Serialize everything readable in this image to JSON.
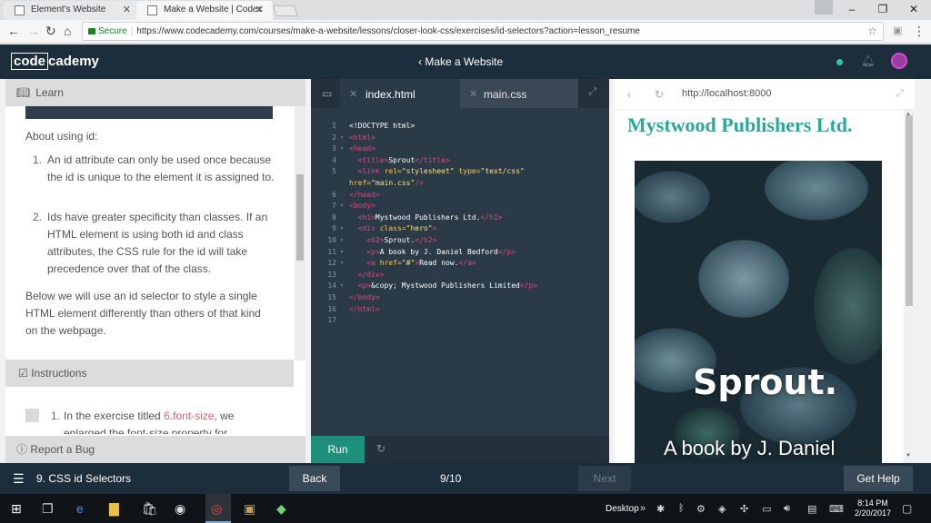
{
  "browser": {
    "tabs": [
      {
        "title": "Element's Website"
      },
      {
        "title": "Make a Website | Codec"
      }
    ],
    "address": {
      "secure_label": "Secure",
      "url": "https://www.codecademy.com/courses/make-a-website/lessons/closer-look-css/exercises/id-selectors?action=lesson_resume"
    }
  },
  "header": {
    "logo_left": "code",
    "logo_right": "cademy",
    "course": "Make a Website"
  },
  "learn": {
    "label": "Learn",
    "intro": "About using id:",
    "points": [
      {
        "num": "1.",
        "line1": "An id attribute can only be used once because",
        "line2": "the id is unique to the element it is assigned to."
      },
      {
        "num": "2.",
        "line1": "Ids have greater specificity than classes. If an",
        "line2": "HTML element is using both id and class",
        "line3": "attributes, the CSS rule for the id will take",
        "line4": "precedence over that of the class."
      }
    ],
    "outro_line1": "Below we will use an id selector to style a single",
    "outro_line2": "HTML element differently than others of that kind",
    "outro_line3": "on the webpage.",
    "instructions_label": "Instructions",
    "task_num": "1.",
    "task_pre": "In the exercise titled ",
    "task_link": "6.font-size",
    "task_post": ", we",
    "task_line2": "enlarged the font-size property for",
    "bug_label": "Report a Bug"
  },
  "editor": {
    "tabs": [
      "index.html",
      "main.css"
    ],
    "run_label": "Run",
    "lines": [
      "1",
      "2",
      "3",
      "4",
      "5",
      "",
      "6",
      "7",
      "8",
      "9",
      "10",
      "11",
      "12",
      "13",
      "14",
      "15",
      "16",
      "17"
    ]
  },
  "preview": {
    "url": "http://localhost:8000",
    "h1": "Mystwood Publishers Ltd.",
    "h2": "Sprout.",
    "p": "A book by J. Daniel"
  },
  "bottom": {
    "lesson": "9. CSS id Selectors",
    "back": "Back",
    "progress": "9/10",
    "next": "Next",
    "help": "Get Help"
  },
  "taskbar": {
    "desktop": "Desktop",
    "time": "8:14 PM",
    "date": "2/20/2017"
  }
}
